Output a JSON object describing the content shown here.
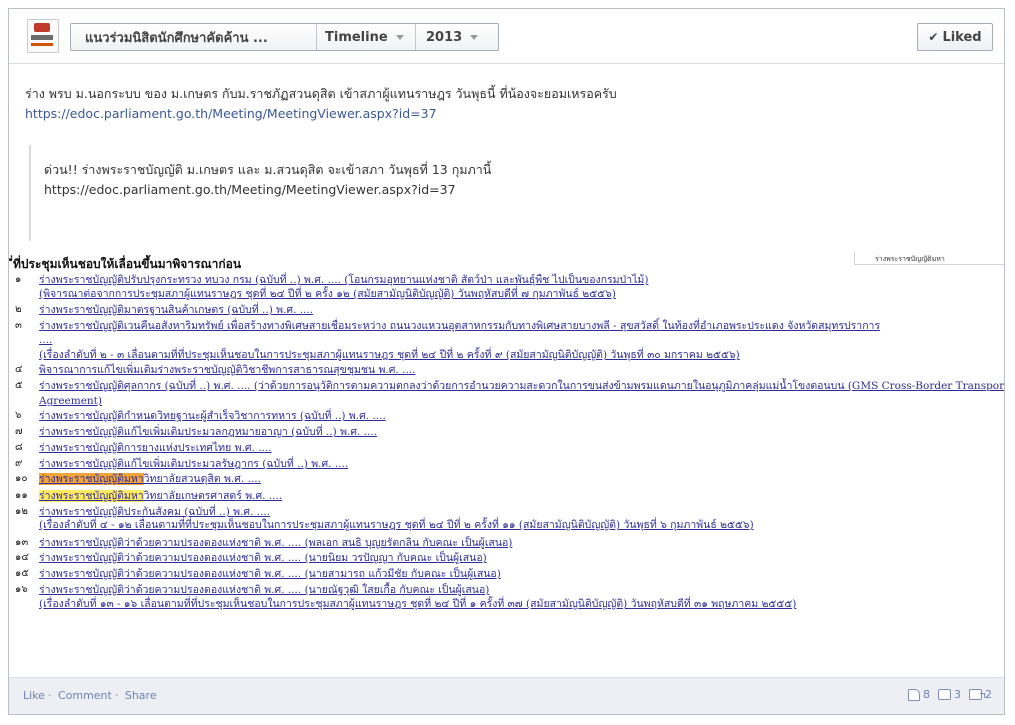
{
  "header": {
    "page_name": "แนวร่วมนิสิตนักศึกษาคัดค้าน ...",
    "timeline_label": "Timeline",
    "year_label": "2013",
    "liked_label": "Liked",
    "liked_icon": "check-icon"
  },
  "post": {
    "text": "ร่าง พรบ ม.นอกระบบ ของ ม.เกษตร กับม.ราชภัฏสวนดุสิต เข้าสภาผู้แทนราษฎร วันพุธนี้ ที่น้องจะยอมเหรอครับ",
    "link": "https://edoc.parliament.go.th/Meeting/MeetingViewer.aspx?id=37",
    "quote_text": "ด่วน!! ร่างพระราชบัญญัติ ม.เกษตร และ ม.สวนดุสิต จะเข้าสภา วันพุธที่ 13 กุมภานี้",
    "quote_link": "https://edoc.parliament.go.th/Meeting/MeetingViewer.aspx?id=37"
  },
  "doc": {
    "heading": "ี่ที่ประชุมเห็นชอบให้เลื่อนขึ้นมาพิจารณาก่อน",
    "side_label": "ร่างพระราชบัญญัติมหา",
    "rows": [
      {
        "num": "๑",
        "text": "ร่างพระราชบัญญัติปรับปรุงกระทรวง ทบวง กรม (ฉบับที่ ..) พ.ศ. .... (โอนกรมอุทยานแห่งชาติ สัตว์ป่า และพันธุ์พืช ไปเป็นของกรมป่าไม้)"
      },
      {
        "num": "",
        "text": "(พิจารณาต่อจากการประชุมสภาผู้แทนราษฎร ชุดที่ ๒๔ ปีที่ ๒ ครั้ง ๑๒ (สมัยสามัญนิติบัญญัติ) วันพฤหัสบดีที่ ๗ กุมภาพันธ์ ๒๕๕๖)"
      },
      {
        "num": "๒",
        "text": "ร่างพระราชบัญญัติมาตรฐานสินค้าเกษตร (ฉบับที่ ..) พ.ศ. ...."
      },
      {
        "num": "๓",
        "text": "ร่างพระราชบัญญัติเวนคืนอสังหาริมทรัพย์ เพื่อสร้างทางพิเศษสายเชื่อมระหว่าง ถนนวงแหวนอุตสาหกรรมกับทางพิเศษสายบางพลี - สุขสวัสดิ์ ในท้องที่อำเภอพระประแดง จังหวัดสมุทรปราการ"
      },
      {
        "num": "",
        "text": "...."
      },
      {
        "num": "",
        "text": "(เรื่องลำดับที่ ๒ - ๓ เลื่อนตามที่ที่ประชุมเห็นชอบในการประชุมสภาผู้แทนราษฎร ชุดที่ ๒๔ ปีที่ ๒ ครั้งที่ ๙ (สมัยสามัญนิติบัญญัติ) วันพุธที่ ๓๐ มกราคม ๒๕๕๖)"
      },
      {
        "num": "๔",
        "text": "พิจารณาการแก้ไขเพิ่มเติมร่างพระราชบัญญัติวิชาชีพการสาธารณสุขชุมชน พ.ศ. ...."
      },
      {
        "num": "๕",
        "text": "ร่างพระราชบัญญัติศุลกากร (ฉบับที่ ..) พ.ศ. .... (ว่าด้วยการอนุวัติการตามความตกลงว่าด้วยการอำนวยความสะดวกในการขนส่งข้ามพรมแดนภายในอนุภูมิภาคลุ่มแม่น้ำโขงตอนบน (GMS Cross-Border Transport"
      },
      {
        "num": "",
        "text": "Agreement)"
      },
      {
        "num": "๖",
        "text": "ร่างพระราชบัญญัติกำหนดวิทยฐานะผู้สำเร็จวิชาการทหาร (ฉบับที่ ..) พ.ศ. ...."
      },
      {
        "num": "๗",
        "text": "ร่างพระราชบัญญัติแก้ไขเพิ่มเติมประมวลกฎหมายอาญา (ฉบับที่ ..) พ.ศ. ...."
      },
      {
        "num": "๘",
        "text": "ร่างพระราชบัญญัติการยางแห่งประเทศไทย พ.ศ. ...."
      },
      {
        "num": "๙",
        "text": "ร่างพระราชบัญญัติแก้ไขเพิ่มเติมประมวลรัษฎากร (ฉบับที่ ..) พ.ศ. ...."
      },
      {
        "num": "๑๐",
        "text_hl": "ร่างพระราชบัญญัติมหา",
        "text": "วิทยาลัยสวนดุสิต พ.ศ. ...."
      },
      {
        "num": "๑๑",
        "text_hl2": "ร่างพระราชบัญญัติมหา",
        "text": "วิทยาลัยเกษตรศาสตร์ พ.ศ. ...."
      },
      {
        "num": "๑๒",
        "text": "ร่างพระราชบัญญัติประกันสังคม (ฉบับที่ ..) พ.ศ. ...."
      },
      {
        "num": "",
        "text": "(เรื่องลำดับที่ ๔ - ๑๒ เลื่อนตามที่ที่ประชุมเห็นชอบในการประชุมสภาผู้แทนราษฎร ชุดที่ ๒๔ ปีที่ ๒ ครั้งที่ ๑๑ (สมัยสามัญนิติบัญญัติ) วันพุธที่ ๖ กุมภาพันธ์ ๒๕๕๖)"
      },
      {
        "num": "๑๓",
        "text": "ร่างพระราชบัญญัติว่าด้วยความปรองดองแห่งชาติ พ.ศ. .... (พลเอก สนธิ บุญยรัตกลิน กับคณะ เป็นผู้เสนอ)"
      },
      {
        "num": "๑๔",
        "text": "ร่างพระราชบัญญัติว่าด้วยความปรองดองแห่งชาติ พ.ศ. .... (นายนิยม วรปัญญา กับคณะ เป็นผู้เสนอ)"
      },
      {
        "num": "๑๕",
        "text": "ร่างพระราชบัญญัติว่าด้วยความปรองดองแห่งชาติ พ.ศ. .... (นายสามารถ แก้วมีชัย กับคณะ เป็นผู้เสนอ)"
      },
      {
        "num": "๑๖",
        "text": "ร่างพระราชบัญญัติว่าด้วยความปรองดองแห่งชาติ พ.ศ. .... (นายณัฐวุฒิ ใสยเกื้อ กับคณะ เป็นผู้เสนอ)"
      },
      {
        "num": "",
        "text": "(เรื่องลำดับที่ ๑๓ - ๑๖ เลื่อนตามที่ที่ประชุมเห็นชอบในการประชุมสภาผู้แทนราษฎร ชุดที่ ๒๔ ปีที่ ๑ ครั้งที่ ๓๗ (สมัยสามัญนิติบัญญัติ) วันพฤหัสบดีที่ ๓๑ พฤษภาคม ๒๕๕๕)"
      }
    ]
  },
  "footer": {
    "like": "Like",
    "comment": "Comment",
    "share": "Share",
    "like_count": "8",
    "comment_count": "3",
    "share_count": "2",
    "like_icon": "thumbs-up-icon",
    "comment_icon": "comment-icon",
    "share_icon": "share-icon"
  }
}
